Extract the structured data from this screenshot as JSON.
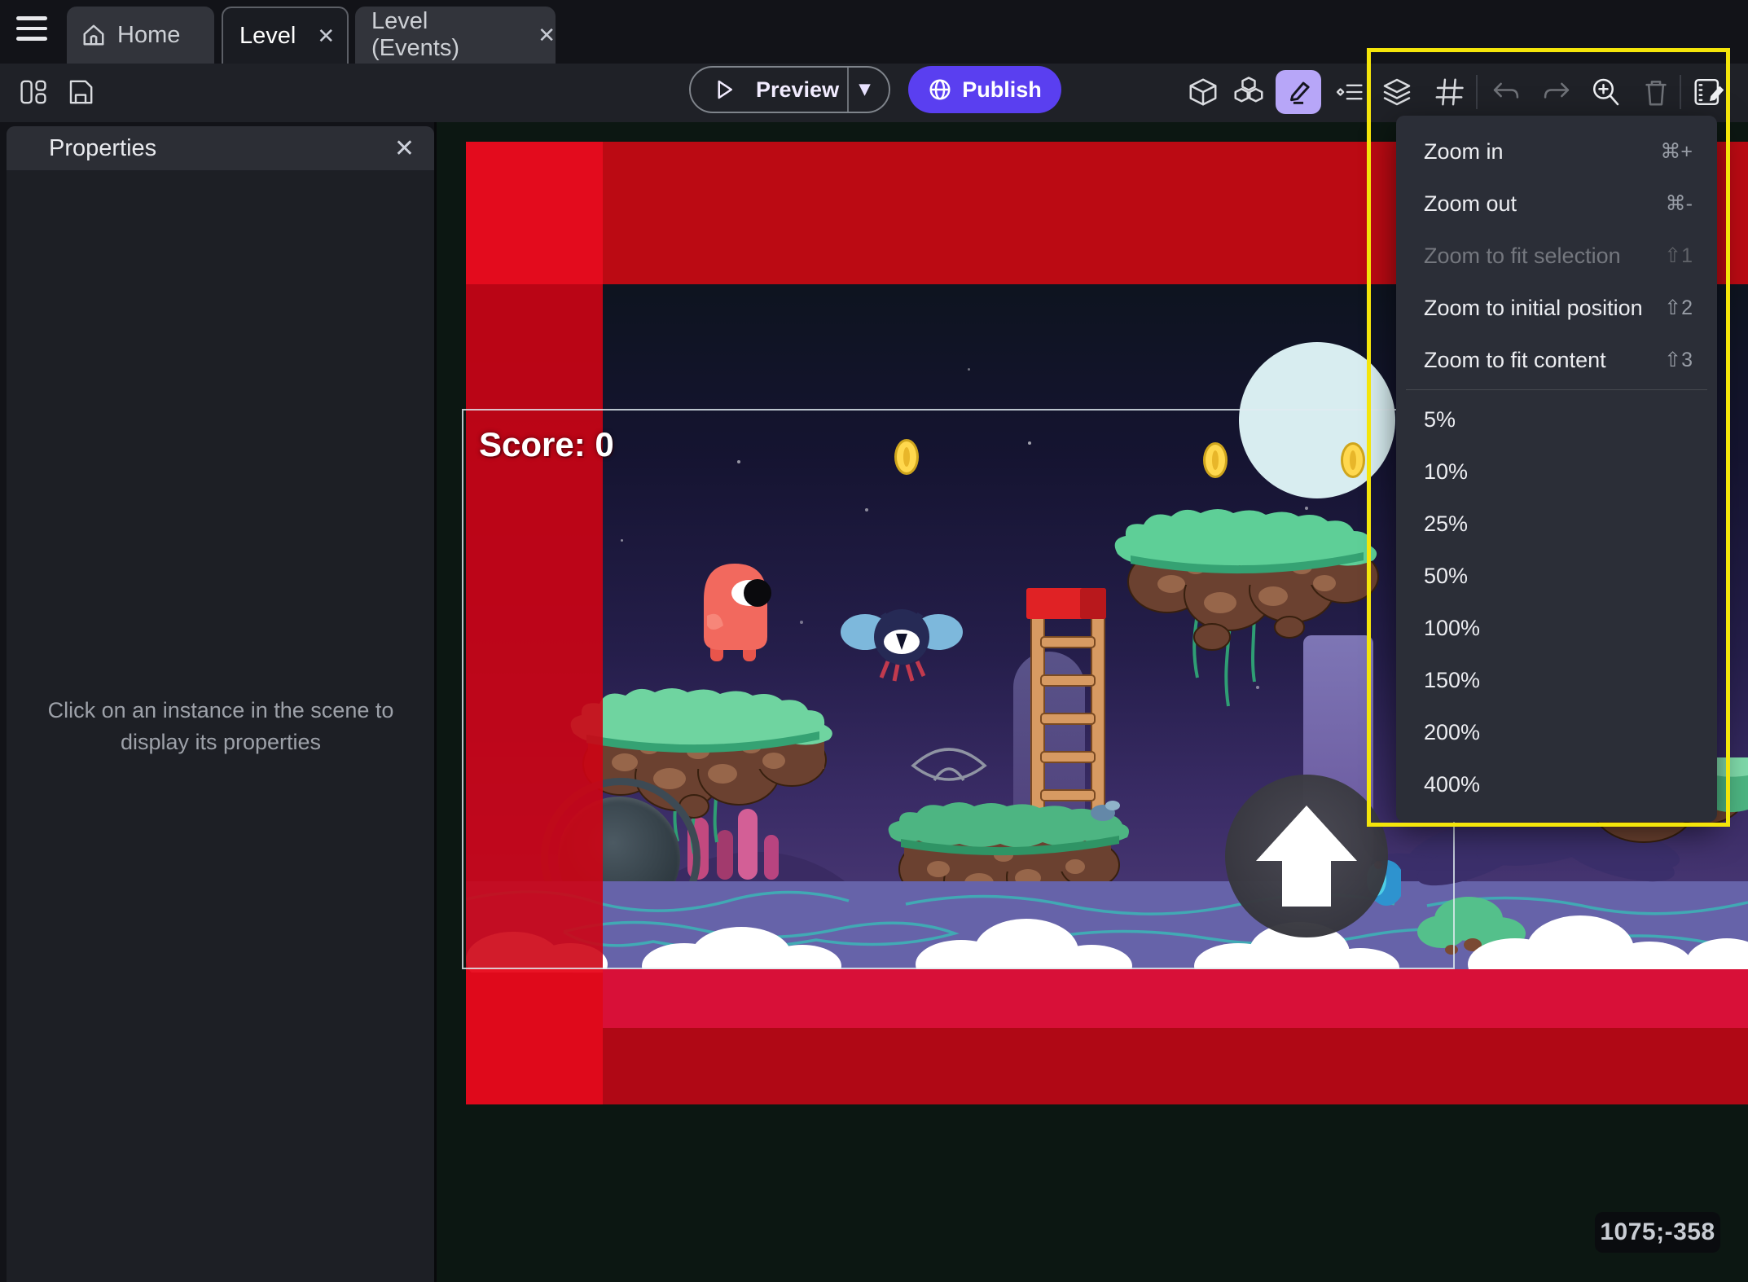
{
  "tab_bar": {
    "tabs": [
      {
        "label": "Home"
      },
      {
        "label": "Level"
      },
      {
        "label": "Level (Events)"
      }
    ]
  },
  "toolbar": {
    "preview_label": "Preview",
    "publish_label": "Publish"
  },
  "properties_panel": {
    "title": "Properties",
    "empty_message": "Click on an instance in the scene to display its properties"
  },
  "scene": {
    "score_label": "Score: 0",
    "coordinates": "1075;-358"
  },
  "zoom_menu": {
    "items": [
      {
        "label": "Zoom in",
        "shortcut": "⌘+"
      },
      {
        "label": "Zoom out",
        "shortcut": "⌘-"
      },
      {
        "label": "Zoom to fit selection",
        "shortcut": "⇧1"
      },
      {
        "label": "Zoom to initial position",
        "shortcut": "⇧2"
      },
      {
        "label": "Zoom to fit content",
        "shortcut": "⇧3"
      }
    ],
    "zoom_levels": [
      "5%",
      "10%",
      "25%",
      "50%",
      "100%",
      "150%",
      "200%",
      "400%"
    ]
  },
  "icons": {
    "close": "✕",
    "caret_down": "▾"
  },
  "colors": {
    "accent_purple": "#5a3ff0",
    "edit_active_bg": "#b7a6f8",
    "highlight_yellow": "#f4e50a",
    "red_band_top": "#bb0a13",
    "red_band_left": "#d00416",
    "crimson_band": "#d81038",
    "dark_red_band": "#b00815"
  }
}
